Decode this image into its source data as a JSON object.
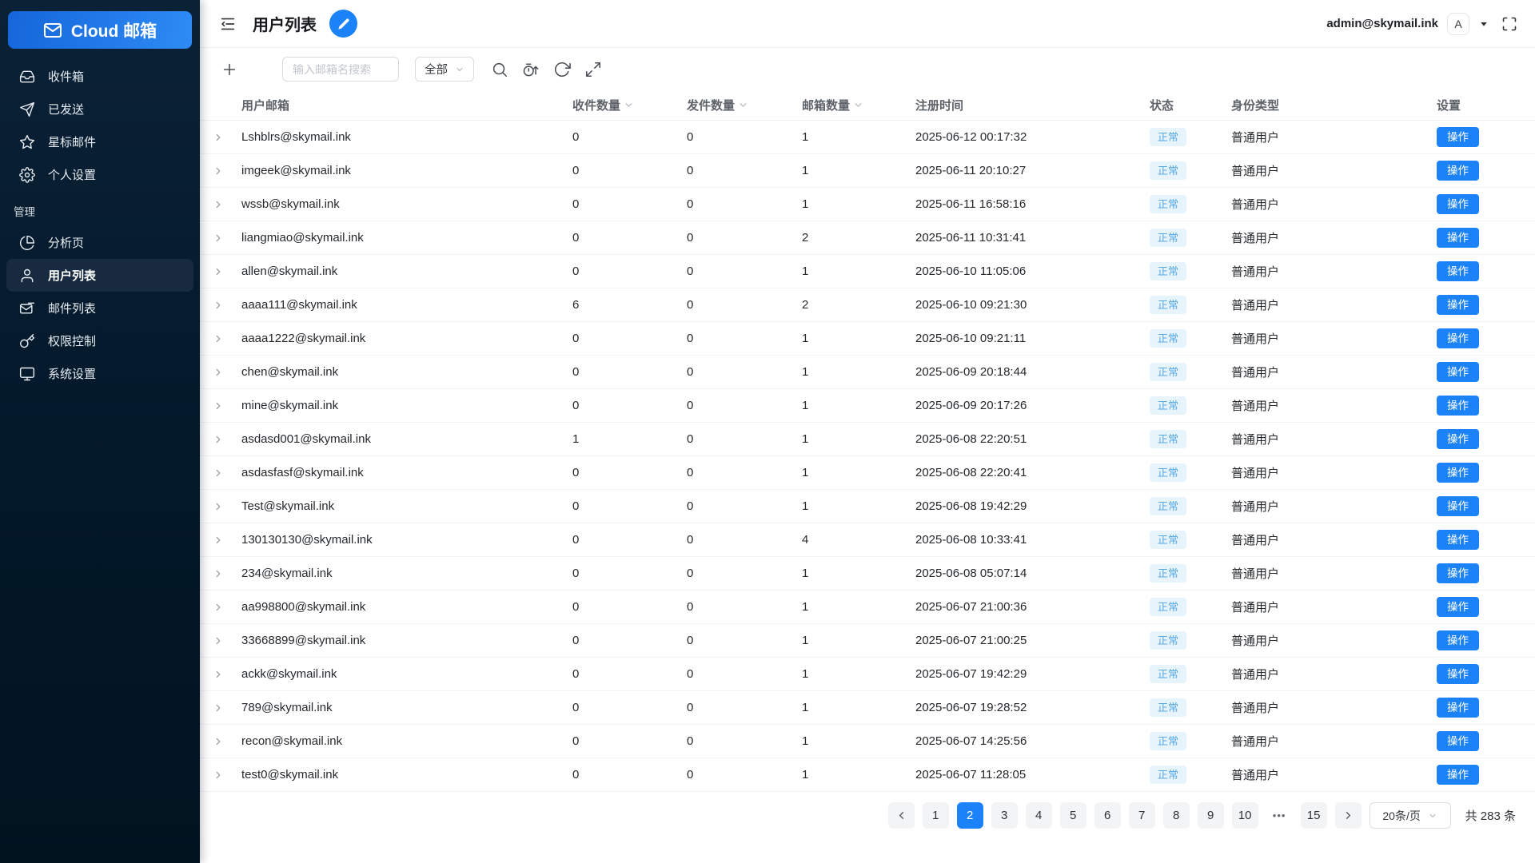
{
  "app": {
    "logo_text": "Cloud 邮箱"
  },
  "colors": {
    "accent": "#1b82f7",
    "sidebar_bg": "#031829",
    "active_item_bg": "#172a40",
    "badge_bg": "#e7f4fc",
    "badge_text": "#57a8e3"
  },
  "icons": {
    "logo": "mail-icon",
    "header_left": "menu-fold-icon",
    "header_edit": "pencil-icon",
    "toolbar": [
      "plus-icon",
      "search-icon",
      "timer-sort-icon",
      "refresh-icon",
      "expand-icon"
    ],
    "account": [
      "avatar",
      "caret-down-icon",
      "fullscreen-icon"
    ]
  },
  "sidebar": {
    "items": [
      {
        "label": "收件箱",
        "icon": "inbox-icon"
      },
      {
        "label": "已发送",
        "icon": "send-icon"
      },
      {
        "label": "星标邮件",
        "icon": "star-icon"
      },
      {
        "label": "个人设置",
        "icon": "gear-icon"
      }
    ],
    "section_label": "管理",
    "admin_items": [
      {
        "label": "分析页",
        "icon": "pie-chart-icon"
      },
      {
        "label": "用户列表",
        "icon": "user-icon",
        "active": true
      },
      {
        "label": "邮件列表",
        "icon": "mail-list-icon"
      },
      {
        "label": "权限控制",
        "icon": "key-icon"
      },
      {
        "label": "系统设置",
        "icon": "monitor-icon"
      }
    ]
  },
  "header": {
    "title": "用户列表",
    "account_email": "admin@skymail.ink",
    "avatar_letter": "A"
  },
  "toolbar": {
    "search_placeholder": "输入邮箱名搜索",
    "filter_value": "全部"
  },
  "table": {
    "columns": [
      {
        "label": "用户邮箱",
        "sortable": false
      },
      {
        "label": "收件数量",
        "sortable": true
      },
      {
        "label": "发件数量",
        "sortable": true
      },
      {
        "label": "邮箱数量",
        "sortable": true
      },
      {
        "label": "注册时间",
        "sortable": false
      },
      {
        "label": "状态",
        "sortable": false
      },
      {
        "label": "身份类型",
        "sortable": false
      },
      {
        "label": "设置",
        "sortable": false
      }
    ],
    "rows": [
      {
        "email": "Lshblrs@skymail.ink",
        "received": "0",
        "sent": "0",
        "mailboxes": "1",
        "registered": "2025-06-12 00:17:32",
        "status": "正常",
        "role": "普通用户",
        "action": "操作"
      },
      {
        "email": "imgeek@skymail.ink",
        "received": "0",
        "sent": "0",
        "mailboxes": "1",
        "registered": "2025-06-11 20:10:27",
        "status": "正常",
        "role": "普通用户",
        "action": "操作"
      },
      {
        "email": "wssb@skymail.ink",
        "received": "0",
        "sent": "0",
        "mailboxes": "1",
        "registered": "2025-06-11 16:58:16",
        "status": "正常",
        "role": "普通用户",
        "action": "操作"
      },
      {
        "email": "liangmiao@skymail.ink",
        "received": "0",
        "sent": "0",
        "mailboxes": "2",
        "registered": "2025-06-11 10:31:41",
        "status": "正常",
        "role": "普通用户",
        "action": "操作"
      },
      {
        "email": "allen@skymail.ink",
        "received": "0",
        "sent": "0",
        "mailboxes": "1",
        "registered": "2025-06-10 11:05:06",
        "status": "正常",
        "role": "普通用户",
        "action": "操作"
      },
      {
        "email": "aaaa111@skymail.ink",
        "received": "6",
        "sent": "0",
        "mailboxes": "2",
        "registered": "2025-06-10 09:21:30",
        "status": "正常",
        "role": "普通用户",
        "action": "操作"
      },
      {
        "email": "aaaa1222@skymail.ink",
        "received": "0",
        "sent": "0",
        "mailboxes": "1",
        "registered": "2025-06-10 09:21:11",
        "status": "正常",
        "role": "普通用户",
        "action": "操作"
      },
      {
        "email": "chen@skymail.ink",
        "received": "0",
        "sent": "0",
        "mailboxes": "1",
        "registered": "2025-06-09 20:18:44",
        "status": "正常",
        "role": "普通用户",
        "action": "操作"
      },
      {
        "email": "mine@skymail.ink",
        "received": "0",
        "sent": "0",
        "mailboxes": "1",
        "registered": "2025-06-09 20:17:26",
        "status": "正常",
        "role": "普通用户",
        "action": "操作"
      },
      {
        "email": "asdasd001@skymail.ink",
        "received": "1",
        "sent": "0",
        "mailboxes": "1",
        "registered": "2025-06-08 22:20:51",
        "status": "正常",
        "role": "普通用户",
        "action": "操作"
      },
      {
        "email": "asdasfasf@skymail.ink",
        "received": "0",
        "sent": "0",
        "mailboxes": "1",
        "registered": "2025-06-08 22:20:41",
        "status": "正常",
        "role": "普通用户",
        "action": "操作"
      },
      {
        "email": "Test@skymail.ink",
        "received": "0",
        "sent": "0",
        "mailboxes": "1",
        "registered": "2025-06-08 19:42:29",
        "status": "正常",
        "role": "普通用户",
        "action": "操作"
      },
      {
        "email": "130130130@skymail.ink",
        "received": "0",
        "sent": "0",
        "mailboxes": "4",
        "registered": "2025-06-08 10:33:41",
        "status": "正常",
        "role": "普通用户",
        "action": "操作"
      },
      {
        "email": "234@skymail.ink",
        "received": "0",
        "sent": "0",
        "mailboxes": "1",
        "registered": "2025-06-08 05:07:14",
        "status": "正常",
        "role": "普通用户",
        "action": "操作"
      },
      {
        "email": "aa998800@skymail.ink",
        "received": "0",
        "sent": "0",
        "mailboxes": "1",
        "registered": "2025-06-07 21:00:36",
        "status": "正常",
        "role": "普通用户",
        "action": "操作"
      },
      {
        "email": "33668899@skymail.ink",
        "received": "0",
        "sent": "0",
        "mailboxes": "1",
        "registered": "2025-06-07 21:00:25",
        "status": "正常",
        "role": "普通用户",
        "action": "操作"
      },
      {
        "email": "ackk@skymail.ink",
        "received": "0",
        "sent": "0",
        "mailboxes": "1",
        "registered": "2025-06-07 19:42:29",
        "status": "正常",
        "role": "普通用户",
        "action": "操作"
      },
      {
        "email": "789@skymail.ink",
        "received": "0",
        "sent": "0",
        "mailboxes": "1",
        "registered": "2025-06-07 19:28:52",
        "status": "正常",
        "role": "普通用户",
        "action": "操作"
      },
      {
        "email": "recon@skymail.ink",
        "received": "0",
        "sent": "0",
        "mailboxes": "1",
        "registered": "2025-06-07 14:25:56",
        "status": "正常",
        "role": "普通用户",
        "action": "操作"
      },
      {
        "email": "test0@skymail.ink",
        "received": "0",
        "sent": "0",
        "mailboxes": "1",
        "registered": "2025-06-07 11:28:05",
        "status": "正常",
        "role": "普通用户",
        "action": "操作"
      }
    ]
  },
  "pagination": {
    "pages": [
      {
        "label": "1"
      },
      {
        "label": "2",
        "active": true
      },
      {
        "label": "3"
      },
      {
        "label": "4"
      },
      {
        "label": "5"
      },
      {
        "label": "6"
      },
      {
        "label": "7"
      },
      {
        "label": "8"
      },
      {
        "label": "9"
      },
      {
        "label": "10"
      },
      {
        "label": "•••",
        "ellipsis": true
      },
      {
        "label": "15"
      }
    ],
    "page_size": "20条/页",
    "total_label": "共 283 条"
  }
}
